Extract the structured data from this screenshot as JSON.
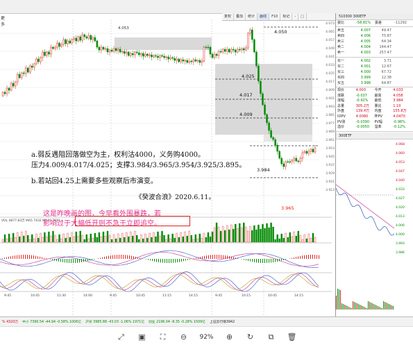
{
  "sidebar": {
    "label": "更多"
  },
  "toolbar": {
    "buttons": [
      "复权",
      "叠加",
      "统计",
      "画线",
      "F10",
      "标记",
      "-",
      "□"
    ]
  },
  "chart": {
    "price_labels": [
      "4.050",
      "4.025",
      "4.017",
      "4.009",
      "3.984",
      "3.965"
    ],
    "high_label": "4.053",
    "bottom_times": [
      "9:45",
      "10:45",
      "11:30",
      "14:00",
      "9:45",
      "10:45",
      "11:15",
      "14:15",
      "9:45",
      "10:15",
      "10:45",
      "14:15"
    ],
    "indicator_header": "VOL 4877.83万 MA5 7432  MA10 7811"
  },
  "annotation": {
    "line1": "a.弱反遇阻回落做空为主，权利沽4000，义务购4000。",
    "line2": "压力4.009/4.017/4.025；支撑3.984/3.965/3.954/3.925/3.895。",
    "line3": "b.若站回4.25上需要多些观察后市演变。",
    "signature": "《癸波合浪》2020.6.11。",
    "note_line1": "这是昨晚画的图，今早看外围暴跌，若",
    "note_line2": "影响过于大幅低开则不急于立即追空。"
  },
  "quote": {
    "title": "510300 300ETF",
    "weibi": "委比",
    "weibi_val": "-58.81%",
    "weicha": "委差",
    "weicha_val": "-11292",
    "asks": [
      {
        "label": "卖五",
        "price": "4.007",
        "vol": "49.47"
      },
      {
        "label": "卖四",
        "price": "4.006",
        "vol": "75.87"
      },
      {
        "label": "卖三",
        "price": "4.005",
        "vol": "64.34"
      },
      {
        "label": "卖二",
        "price": "4.004",
        "vol": "144.47"
      },
      {
        "label": "卖一",
        "price": "4.003",
        "vol": "257.47"
      }
    ],
    "bids": [
      {
        "label": "买一",
        "price": "4.002",
        "vol": "3.71"
      },
      {
        "label": "买二",
        "price": "4.001",
        "vol": "12.67"
      },
      {
        "label": "买三",
        "price": "4.000",
        "vol": "67.72"
      },
      {
        "label": "买四",
        "price": "3.999",
        "vol": "12.38"
      },
      {
        "label": "买五",
        "price": "3.998",
        "vol": "64.87"
      }
    ],
    "stats": [
      [
        "现价",
        "4.003",
        "今开",
        "4.033"
      ],
      [
        "涨跌",
        "-0.037",
        "最高",
        "4.058"
      ],
      [
        "涨幅",
        "-0.92%",
        "最低",
        "3.984"
      ],
      [
        "总量",
        "305.2万",
        "量比",
        "1.10"
      ],
      [
        "外盘",
        "139.4万",
        "内盘",
        "155.8万"
      ],
      [
        "IOPV",
        "4.0080",
        "昨PV",
        "4.0470"
      ],
      [
        "PV涨",
        "-0.0390",
        "PV幅",
        "-0.96%"
      ],
      [
        "溢价",
        "-0.0050",
        "溢率",
        "-0.12%"
      ]
    ],
    "mini_title": "300ETF",
    "mini_prices": [
      "4.068",
      "4.060",
      "4.053",
      "4.047",
      "4.040",
      "4.033",
      "4.027",
      "4.020",
      "4.013",
      "4.006",
      "4.000",
      "3.993",
      "3.986"
    ]
  },
  "status": {
    "items": [
      "% 4320万",
      "中小 7390.54 -44.94 -0.58% 1006亿",
      "沪深 3985.88 -43.03 -1.06% 1971亿",
      "创业 2196.04 -8.35 -0.28% 1509亿",
      "上证云行情3942"
    ]
  },
  "viewer": {
    "zoom": "92%"
  }
}
